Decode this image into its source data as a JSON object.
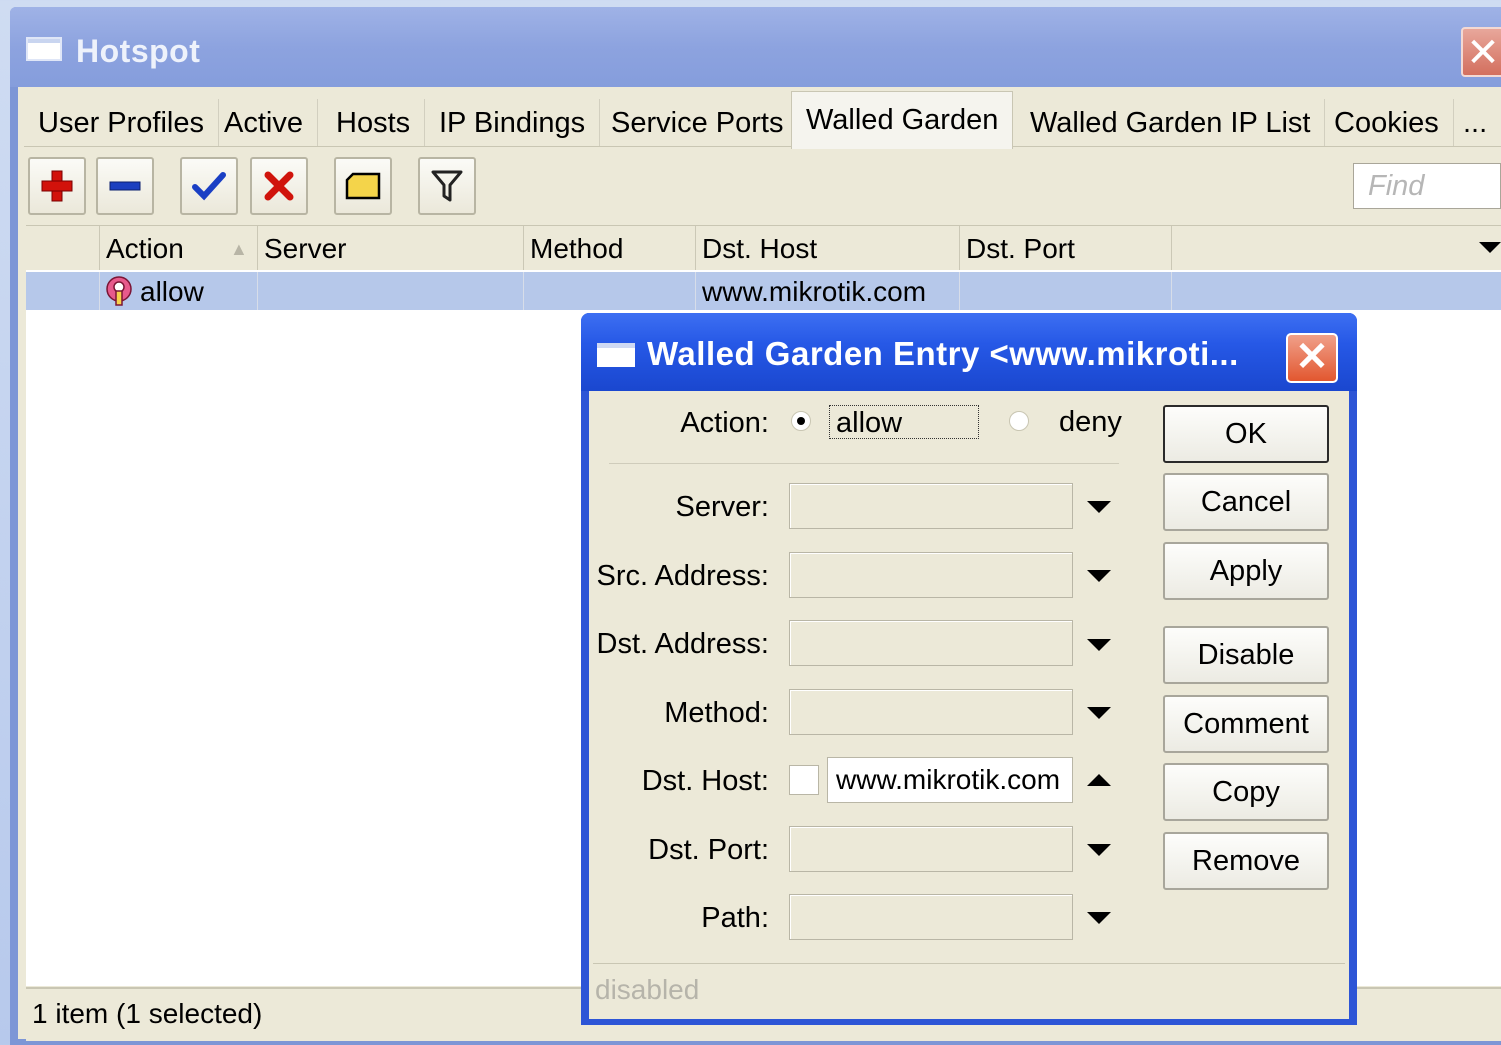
{
  "window": {
    "title": "Hotspot",
    "close_label": "✕"
  },
  "tabs": [
    {
      "label": "User Profiles"
    },
    {
      "label": "Active"
    },
    {
      "label": "Hosts"
    },
    {
      "label": "IP Bindings"
    },
    {
      "label": "Service Ports"
    },
    {
      "label": "Walled Garden"
    },
    {
      "label": "Walled Garden IP List"
    },
    {
      "label": "Cookies"
    },
    {
      "label": "..."
    }
  ],
  "active_tab": "Walled Garden",
  "toolbar": {
    "find_placeholder": "Find"
  },
  "table": {
    "columns": [
      "Action",
      "Server",
      "Method",
      "Dst. Host",
      "Dst. Port"
    ],
    "rows": [
      {
        "action": "allow",
        "server": "",
        "method": "",
        "dst_host": "www.mikrotik.com",
        "dst_port": ""
      }
    ]
  },
  "statusbar": {
    "text": "1 item (1 selected)"
  },
  "dialog": {
    "title": "Walled Garden Entry <www.mikroti...",
    "close_label": "✕",
    "action_label": "Action:",
    "action_allow": "allow",
    "action_deny": "deny",
    "fields": {
      "server": {
        "label": "Server:",
        "value": ""
      },
      "src_address": {
        "label": "Src. Address:",
        "value": ""
      },
      "dst_address": {
        "label": "Dst. Address:",
        "value": ""
      },
      "method": {
        "label": "Method:",
        "value": ""
      },
      "dst_host": {
        "label": "Dst. Host:",
        "value": "www.mikrotik.com"
      },
      "dst_port": {
        "label": "Dst. Port:",
        "value": ""
      },
      "path": {
        "label": "Path:",
        "value": ""
      }
    },
    "buttons": {
      "ok": "OK",
      "cancel": "Cancel",
      "apply": "Apply",
      "disable": "Disable",
      "comment": "Comment",
      "copy": "Copy",
      "remove": "Remove"
    },
    "status": "disabled"
  }
}
